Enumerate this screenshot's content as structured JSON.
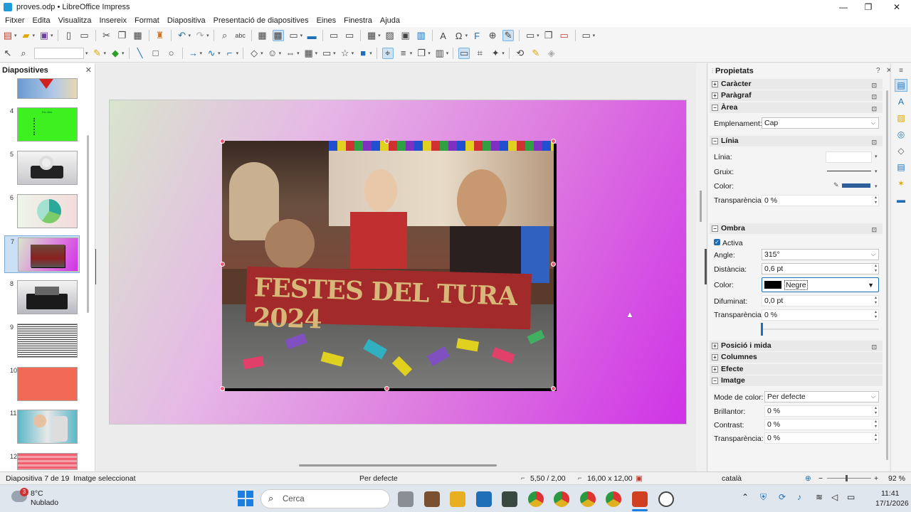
{
  "window": {
    "title": "proves.odp • LibreOffice Impress",
    "minimize": "—",
    "maximize": "❐",
    "close": "✕"
  },
  "menu": [
    "Fitxer",
    "Edita",
    "Visualitza",
    "Insereix",
    "Format",
    "Diapositiva",
    "Presentació de diapositives",
    "Eines",
    "Finestra",
    "Ajuda"
  ],
  "slides_panel": {
    "title": "Diapositives",
    "close": "✕",
    "thumbs": [
      {
        "num": "4"
      },
      {
        "num": "5"
      },
      {
        "num": "6"
      },
      {
        "num": "7"
      },
      {
        "num": "8"
      },
      {
        "num": "9"
      },
      {
        "num": "10"
      },
      {
        "num": "11"
      },
      {
        "num": "12"
      }
    ],
    "slide4_title": "Els dies"
  },
  "photo": {
    "banner_text": "FESTES DEL TURA 2024"
  },
  "properties": {
    "title": "Propietats",
    "help": "?",
    "close": "✕",
    "menu": "≡",
    "caracter": "Caràcter",
    "paragraf": "Paràgraf",
    "area": "Àrea",
    "emplenament_label": "Emplenament:",
    "emplenament_value": "Cap",
    "linia_section": "Línia",
    "linia_label": "Línia:",
    "gruix_label": "Gruix:",
    "color_label": "Color:",
    "transparencia_label": "Transparència:",
    "transparencia_value": "0 %",
    "ombra": "Ombra",
    "activa": "Activa",
    "angle_label": "Angle:",
    "angle_value": "315°",
    "distancia_label": "Distància:",
    "distancia_value": "0,6 pt",
    "ombra_color_label": "Color:",
    "ombra_color_value": "Negre",
    "difuminat_label": "Difuminat:",
    "difuminat_value": "0,0 pt",
    "ombra_transp_label": "Transparència:",
    "ombra_transp_value": "0 %",
    "posicio": "Posició i mida",
    "columnes": "Columnes",
    "efecte": "Efecte",
    "imatge": "Imatge",
    "mode_label": "Mode de color:",
    "mode_value": "Per defecte",
    "brillantor_label": "Brillantor:",
    "brillantor_value": "0 %",
    "contrast_label": "Contrast:",
    "contrast_value": "0 %",
    "img_transp_label": "Transparència:",
    "img_transp_value": "0 %"
  },
  "status": {
    "slide": "Diapositiva 7 de 19",
    "selection": "Imatge seleccionat",
    "layout": "Per defecte",
    "pos": "5,50 / 2,00",
    "size": "16,00 x 12,00",
    "lang": "català",
    "zoom": "92 %"
  },
  "taskbar": {
    "weather_temp": "8°C",
    "weather_desc": "Nublado",
    "weather_badge": "3",
    "search": "Cerca",
    "time": "11:41",
    "date": "17/1/2026"
  },
  "colors": {
    "accent": "#1e6fb8",
    "slide_grad_end": "#cf33e6",
    "selected_thumb": "#cce0f5",
    "handle": "#f05a78"
  }
}
